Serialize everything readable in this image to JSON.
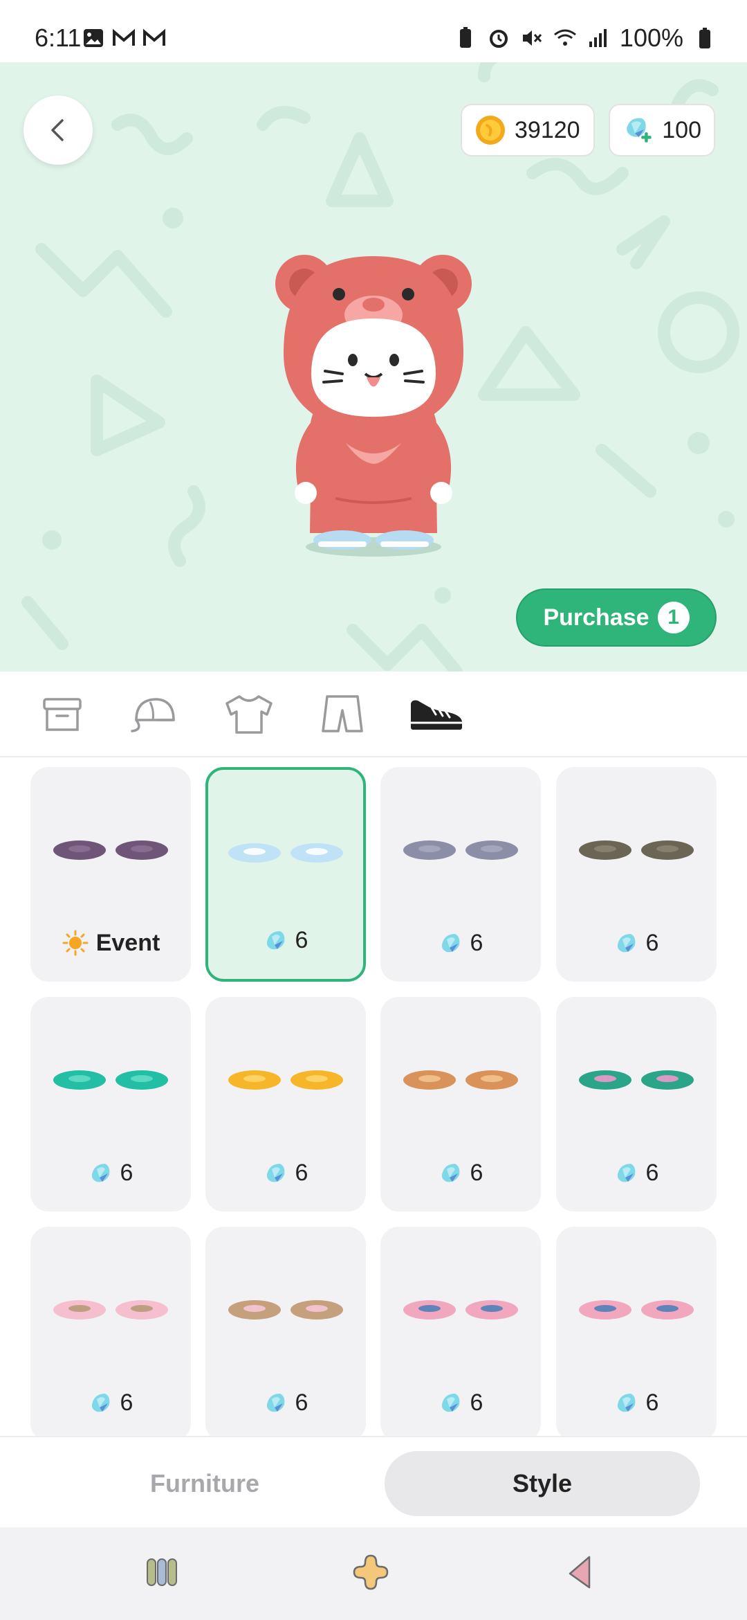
{
  "status_bar": {
    "time": "6:11",
    "battery": "100%",
    "left_icons": [
      "image-icon",
      "gmail-icon",
      "gmail-icon"
    ],
    "right_icons": [
      "battery-saver-icon",
      "alarm-icon",
      "mute-icon",
      "wifi-icon",
      "signal-icon",
      "battery-icon"
    ]
  },
  "header": {
    "coins": "39120",
    "gems": "100"
  },
  "purchase": {
    "label": "Purchase",
    "count": "1"
  },
  "category_tabs": [
    {
      "name": "storage-box-icon",
      "active": false
    },
    {
      "name": "cap-icon",
      "active": false
    },
    {
      "name": "shirt-icon",
      "active": false
    },
    {
      "name": "shorts-icon",
      "active": false
    },
    {
      "name": "sneaker-icon",
      "active": true
    }
  ],
  "items": [
    {
      "price": "Event",
      "event": true,
      "colors": [
        "#6f5577",
        "#8d6f94"
      ],
      "selected": false
    },
    {
      "price": "6",
      "colors": [
        "#bfe2f6",
        "#ffffff"
      ],
      "selected": true
    },
    {
      "price": "6",
      "colors": [
        "#8c8ea8",
        "#a6a8bf"
      ],
      "selected": false
    },
    {
      "price": "6",
      "colors": [
        "#6a6554",
        "#8a8472"
      ],
      "selected": false
    },
    {
      "price": "6",
      "colors": [
        "#23bfa4",
        "#63dcc5"
      ],
      "selected": false
    },
    {
      "price": "6",
      "colors": [
        "#f7b52a",
        "#ffd56a"
      ],
      "selected": false
    },
    {
      "price": "6",
      "colors": [
        "#d9935a",
        "#f3c38f"
      ],
      "selected": false
    },
    {
      "price": "6",
      "colors": [
        "#2aa58a",
        "#ee99cc"
      ],
      "selected": false
    },
    {
      "price": "6",
      "colors": [
        "#f5bfcf",
        "#b79a78"
      ],
      "selected": false
    },
    {
      "price": "6",
      "colors": [
        "#c4a07c",
        "#f7c6d6"
      ],
      "selected": false
    },
    {
      "price": "6",
      "colors": [
        "#f1a8be",
        "#4e7fb8"
      ],
      "selected": false
    },
    {
      "price": "6",
      "colors": [
        "#f1a8be",
        "#4e7fb8"
      ],
      "selected": false
    }
  ],
  "bottom_tabs": {
    "furniture": "Furniture",
    "style": "Style"
  },
  "colors": {
    "accent": "#2fb57a",
    "hero_bg": "#e1f4ea",
    "card_bg": "#f2f2f4"
  }
}
